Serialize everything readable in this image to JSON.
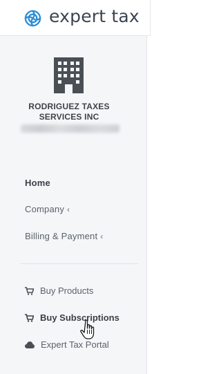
{
  "header": {
    "brand": "expert tax",
    "logo_icon": "swirl-logo-icon"
  },
  "company": {
    "name_line1": "RODRIGUEZ TAXES",
    "name_line2": "SERVICES INC",
    "icon": "building-icon"
  },
  "nav": {
    "home": "Home",
    "company": "Company",
    "billing": "Billing & Payment",
    "chevron": "‹"
  },
  "links": {
    "buy_products": "Buy Products",
    "buy_subscriptions": "Buy Subscriptions",
    "portal": "Expert Tax Portal"
  },
  "colors": {
    "brand_blue": "#2c8ed6",
    "text_dark": "#3a3f45",
    "text_muted": "#5a6169"
  }
}
